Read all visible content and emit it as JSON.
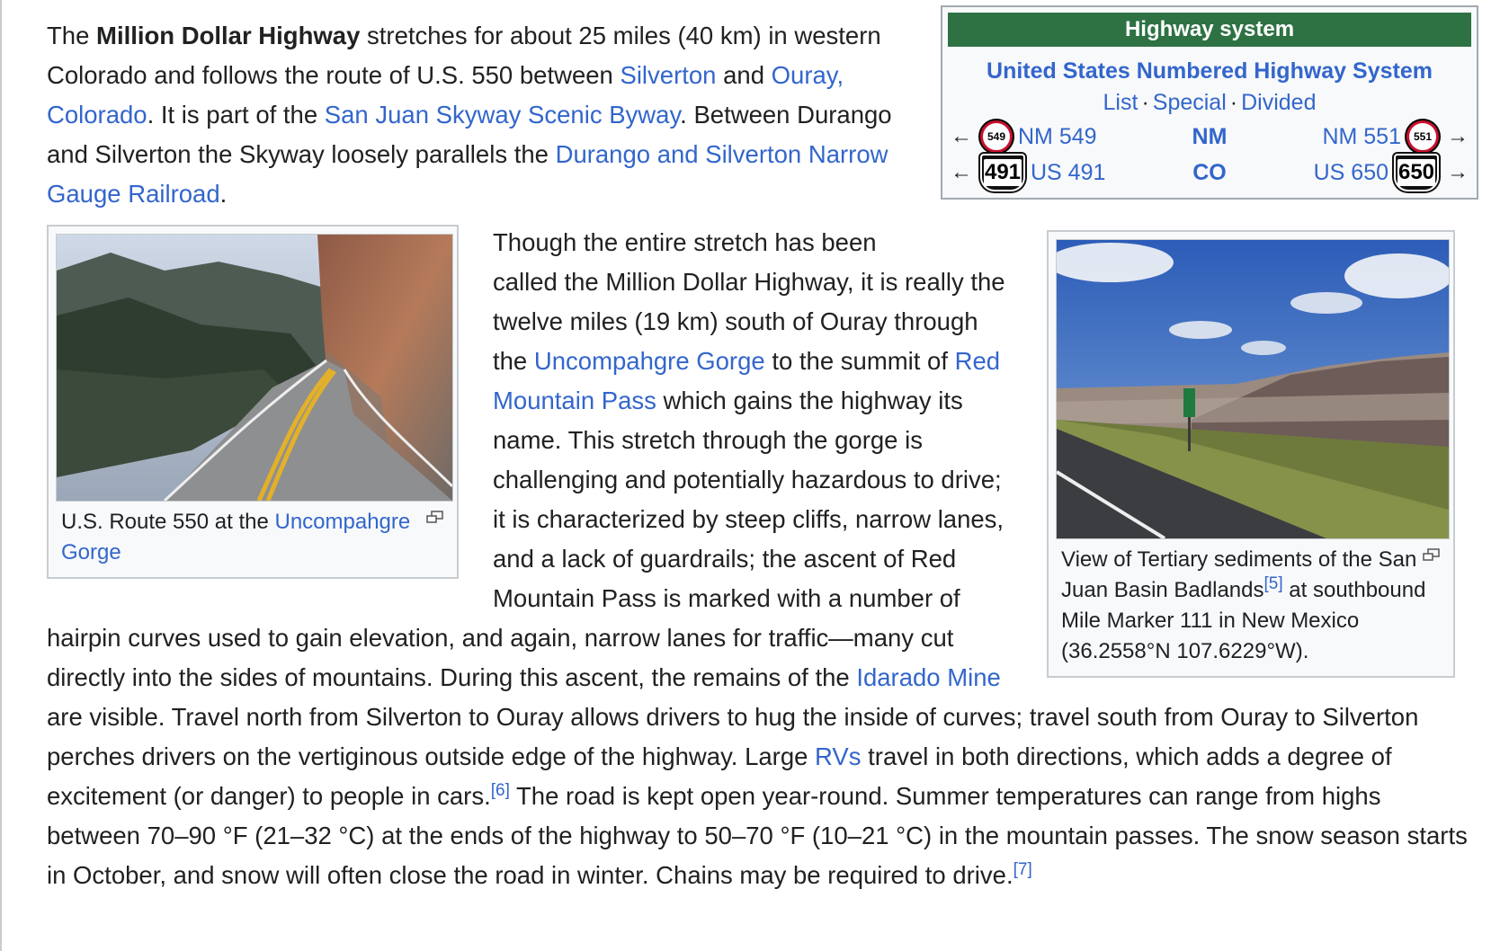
{
  "intro": {
    "t1": "The ",
    "bold_title": "Million Dollar Highway",
    "t2": " stretches for about 25 miles (40 km) in western Colorado and follows the route of U.S. 550 between ",
    "link_silverton": "Silverton",
    "t3": " and ",
    "link_ouray": "Ouray, Colorado",
    "t4": ". It is part of the ",
    "link_skyway": "San Juan Skyway Scenic Byway",
    "t5": ". Between Durango and Silverton the Skyway loosely parallels the ",
    "link_railroad": "Durango and Silverton Narrow Gauge Railroad",
    "t6": "."
  },
  "infobox": {
    "header": "Highway system",
    "system_link": "United States Numbered Highway System",
    "links": [
      "List",
      "Special",
      "Divided"
    ],
    "rows": [
      {
        "left_arrow": "←",
        "left_shield": "549",
        "left_label": "NM 549",
        "state": "NM",
        "right_label": "NM 551",
        "right_shield": "551",
        "right_arrow": "→"
      },
      {
        "left_arrow": "←",
        "left_shield": "491",
        "left_label": "US 491",
        "state": "CO",
        "right_label": "US 650",
        "right_shield": "650",
        "right_arrow": "→"
      }
    ]
  },
  "thumb_left": {
    "caption_text": "U.S. Route 550 at the ",
    "caption_link": "Uncompahgre Gorge"
  },
  "thumb_right": {
    "caption_t1": "View of Tertiary sediments of the San Juan Basin Badlands",
    "caption_ref": "[5]",
    "caption_t2": " at southbound Mile Marker 111 in New Mexico (36.2558°N 107.6229°W)."
  },
  "body": {
    "b1": "Though the entire stretch has been called the Million Dollar Highway, it is really the twelve miles (19 km) south of Ouray through the ",
    "link_gorge": "Uncompahgre Gorge",
    "b2": " to the summit of ",
    "link_pass": "Red Mountain Pass",
    "b3": " which gains the highway its name. This stretch through the gorge is challenging and potentially hazardous to drive; it is characterized by steep cliffs, narrow lanes, and a lack of guardrails; the ascent of Red Mountain Pass is marked with a number of hairpin curves used to gain elevation, and again, narrow lanes for traffic—many cut directly into the sides of mountains. During this ascent, the remains of the ",
    "link_mine": "Idarado Mine",
    "b4": " are visible. Travel north from Silverton to Ouray allows drivers to hug the inside of curves; travel south from Ouray to Silverton perches drivers on the vertiginous outside edge of the highway. Large ",
    "link_rvs": "RVs",
    "b5": " travel in both directions, which adds a degree of excitement (or danger) to people in cars.",
    "ref6": "[6]",
    "b6": " The road is kept open year-round. Summer temperatures can range from highs between 70–90 °F (21–32 °C) at the ends of the highway to 50–70 °F (10–21 °C) in the mountain passes. The snow season starts in October, and snow will often close the road in winter. Chains may be required to drive.",
    "ref7": "[7]"
  }
}
